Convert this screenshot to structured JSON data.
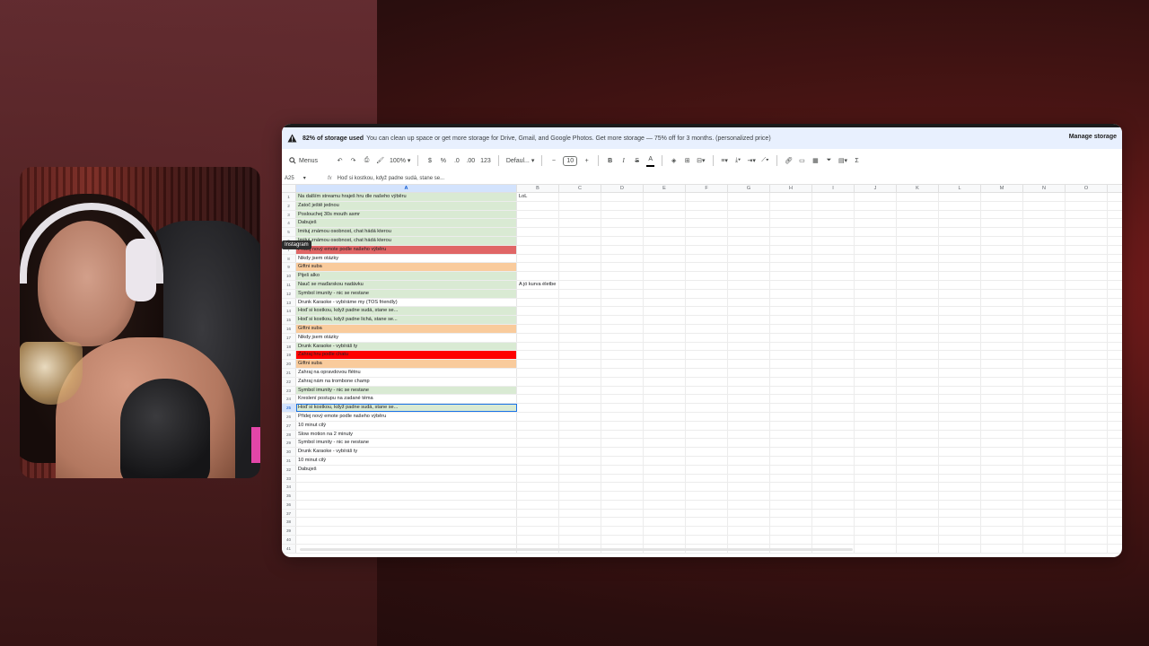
{
  "banner": {
    "bold_text": "82% of storage used",
    "text": "You can clean up space or get more storage for Drive, Gmail, and Google Photos. Get more storage — 75% off for 3 months. (personalized price)",
    "manage_label": "Manage storage"
  },
  "toolbar": {
    "menus_label": "Menus",
    "zoom": "100%",
    "currency": "$",
    "percent": "%",
    "dec_decrease": ".0",
    "dec_increase": ".00",
    "number_format": "123",
    "font_name": "Defaul...",
    "font_size": "10",
    "minus": "−",
    "plus": "+",
    "bold": "B",
    "italic": "I",
    "strike": "S",
    "text_color": "A",
    "sigma": "Σ"
  },
  "formula_bar": {
    "cell_ref": "A25",
    "content": "Hoď si kostkou, když padne sudá, stane se..."
  },
  "columns": [
    "A",
    "B",
    "C",
    "D",
    "E",
    "F",
    "G",
    "H",
    "I",
    "J",
    "K",
    "L",
    "M",
    "N",
    "O"
  ],
  "tooltip": "Instagram",
  "colors": {
    "green": "#d9ead3",
    "red_light": "#e06666",
    "red": "#ff0000",
    "orange": "#f9cb9c",
    "selection": "#1a73e8"
  },
  "rows": [
    {
      "n": "1",
      "a": "Na dalším streamu hraješ hru dle našeho výběru",
      "b": "LoL",
      "fill": "green"
    },
    {
      "n": "2",
      "a": "Zatoč ještě jednou",
      "b": "",
      "fill": "green"
    },
    {
      "n": "3",
      "a": "Poslouchej 30s mouth asmr",
      "b": "",
      "fill": "green"
    },
    {
      "n": "4",
      "a": "Dabuješ",
      "b": "",
      "fill": "green"
    },
    {
      "n": "5",
      "a": "Imituj známou osobnost, chat hádá kterou",
      "b": "",
      "fill": "green"
    },
    {
      "n": "6",
      "a": "Imituj známou osobnost, chat hádá kterou",
      "b": "",
      "fill": "green"
    },
    {
      "n": "7",
      "a": "Přidej nový emote podle našeho výběru",
      "b": "",
      "fill": "red_light"
    },
    {
      "n": "8",
      "a": "Nikdy jsem otázky",
      "b": "",
      "fill": ""
    },
    {
      "n": "9",
      "a": "Giftni suba",
      "b": "",
      "fill": "orange"
    },
    {
      "n": "10",
      "a": "Piješ alko",
      "b": "",
      "fill": "green"
    },
    {
      "n": "11",
      "a": "Nauč se maďarskou nadávku",
      "b": "A jó kurva életbe",
      "fill": "green"
    },
    {
      "n": "12",
      "a": "Symbol imunity - nic se nestane",
      "b": "",
      "fill": "green"
    },
    {
      "n": "13",
      "a": "Drunk Karaoke - vybíráme my (TOS friendly)",
      "b": "",
      "fill": ""
    },
    {
      "n": "14",
      "a": "Hoď si kostkou, když padne sudá, stane se...",
      "b": "",
      "fill": "green"
    },
    {
      "n": "15",
      "a": "Hoď si kostkou, když padne lichá, stane se...",
      "b": "",
      "fill": "green"
    },
    {
      "n": "16",
      "a": "Giftni suba",
      "b": "",
      "fill": "orange"
    },
    {
      "n": "17",
      "a": "Nikdy jsem otázky",
      "b": "",
      "fill": ""
    },
    {
      "n": "18",
      "a": "Drunk Karaoke - vybíráš ty",
      "b": "",
      "fill": "green"
    },
    {
      "n": "19",
      "a": "Zahraj hru podle chatu",
      "b": "",
      "fill": "red"
    },
    {
      "n": "20",
      "a": "Giftni suba",
      "b": "",
      "fill": "orange"
    },
    {
      "n": "21",
      "a": "Zahraj na opravdovou flétnu",
      "b": "",
      "fill": ""
    },
    {
      "n": "22",
      "a": "Zahraj nám na trombone champ",
      "b": "",
      "fill": ""
    },
    {
      "n": "23",
      "a": "Symbol imunity - nic se nestane",
      "b": "",
      "fill": "green"
    },
    {
      "n": "24",
      "a": "Kreslení postupu na zadané téma",
      "b": "",
      "fill": ""
    },
    {
      "n": "25",
      "a": "Hoď si kostkou, když padne sudá, stane se...",
      "b": "",
      "fill": "green",
      "selected": true
    },
    {
      "n": "26",
      "a": "Přidej nový emote podle našeho výběru",
      "b": "",
      "fill": ""
    },
    {
      "n": "27",
      "a": "10 minut cilý",
      "b": "",
      "fill": ""
    },
    {
      "n": "28",
      "a": "Slow motion na 2 minuty",
      "b": "",
      "fill": ""
    },
    {
      "n": "29",
      "a": "Symbol imunity - nic se nestane",
      "b": "",
      "fill": ""
    },
    {
      "n": "30",
      "a": "Drunk Karaoke - vybíráš ty",
      "b": "",
      "fill": ""
    },
    {
      "n": "31",
      "a": "10 minut cilý",
      "b": "",
      "fill": ""
    },
    {
      "n": "32",
      "a": "Dabuješ",
      "b": "",
      "fill": ""
    },
    {
      "n": "33",
      "a": "",
      "b": "",
      "fill": ""
    },
    {
      "n": "34",
      "a": "",
      "b": "",
      "fill": ""
    },
    {
      "n": "35",
      "a": "",
      "b": "",
      "fill": ""
    },
    {
      "n": "36",
      "a": "",
      "b": "",
      "fill": ""
    },
    {
      "n": "37",
      "a": "",
      "b": "",
      "fill": ""
    },
    {
      "n": "38",
      "a": "",
      "b": "",
      "fill": ""
    },
    {
      "n": "39",
      "a": "",
      "b": "",
      "fill": ""
    },
    {
      "n": "40",
      "a": "",
      "b": "",
      "fill": ""
    },
    {
      "n": "41",
      "a": "",
      "b": "",
      "fill": ""
    }
  ]
}
